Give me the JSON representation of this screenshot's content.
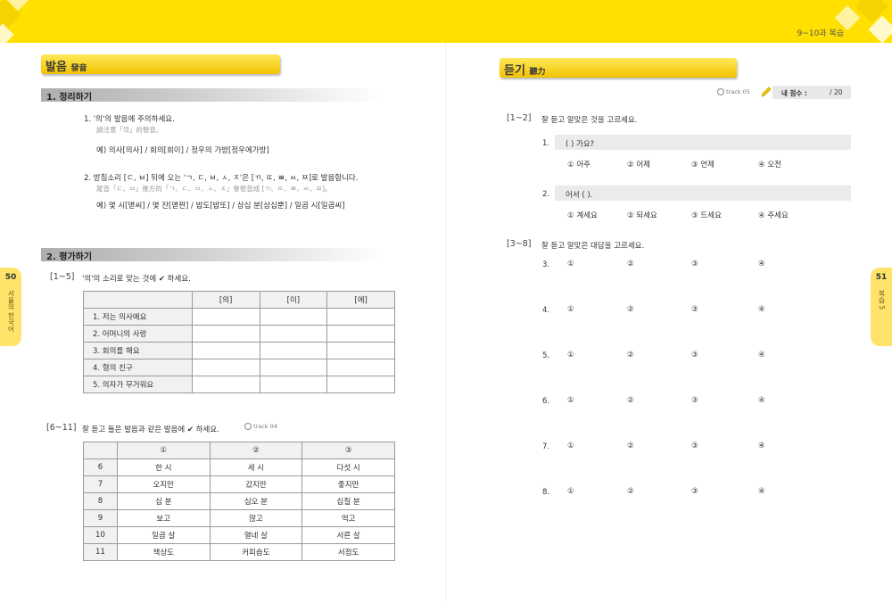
{
  "header": {
    "chapter_label": "9~10과 복습"
  },
  "left": {
    "section_title": "발음",
    "section_title_cn": "發音",
    "sub1_title": "1. 정리하기",
    "rule1": {
      "text": "1.  '의'의 발음에 주의하세요.",
      "cn": "請注意「의」的發音。",
      "example": "예) 의사[의사] / 회의[회이] / 정우의 가방[정우에가방]"
    },
    "rule2": {
      "text": "2.  받침소리 [ㄷ, ㅂ] 뒤에 오는 'ㄱ, ㄷ, ㅂ, ㅅ, ㅈ'은 [ㄲ, ㄸ, ㅃ, ㅆ, ㅉ]로 발음합니다.",
      "cn": "尾音「ㄷ、ㅂ」後方的「ㄱ、ㄷ、ㅂ、ㅅ、ㅈ」會發音成 [ㄲ、ㄸ、ㅃ、ㅆ、ㅉ]。",
      "example": "예) 몇 시[멷씨] / 몇 잔[멷짠] / 밥도[밥또] / 삼십 분[삼십뿐] / 일곱 시[일곱씨]"
    },
    "sub2_title": "2. 평가하기",
    "q1_5": {
      "range": "[1~5]",
      "instruction": "'의'의 소리로 맞는 것에 ✔ 하세요.",
      "headers": [
        "",
        "[의]",
        "[이]",
        "[에]"
      ],
      "rows": [
        "1. 저는 의사예요",
        "2. 어머니의 사랑",
        "3. 회의를 해요",
        "4. 형의 친구",
        "5. 의자가 무거워요"
      ]
    },
    "q6_11": {
      "range": "[6~11]",
      "instruction": "잘 듣고 들은 발음과 같은 발음에 ✔ 하세요.",
      "track": "track 04",
      "headers": [
        "",
        "①",
        "②",
        "③"
      ],
      "rows": [
        [
          "6",
          "한 시",
          "세 시",
          "다섯 시"
        ],
        [
          "7",
          "오지만",
          "갔지만",
          "좋지만"
        ],
        [
          "8",
          "십 분",
          "십오 분",
          "십칠 분"
        ],
        [
          "9",
          "보고",
          "않고",
          "먹고"
        ],
        [
          "10",
          "일곱 살",
          "열네 살",
          "서른 살"
        ],
        [
          "11",
          "책상도",
          "커피숍도",
          "서점도"
        ]
      ]
    },
    "side_tab": {
      "page": "50",
      "text": "서울의 한국어"
    }
  },
  "right": {
    "section_title": "듣기",
    "section_title_cn": "聽力",
    "track": "track 05",
    "score_label": "내 점수 :",
    "score_total": "/ 20",
    "q1_2": {
      "range": "[1~2]",
      "instruction": "잘 듣고 알맞은 것을 고르세요.",
      "items": [
        {
          "num": "1.",
          "prompt": "(              ) 가요?",
          "options": [
            "① 아주",
            "② 어제",
            "③ 언제",
            "④ 오전"
          ]
        },
        {
          "num": "2.",
          "prompt": "어서 (              ).",
          "options": [
            "① 계세요",
            "② 되세요",
            "③ 드세요",
            "④ 주세요"
          ]
        }
      ]
    },
    "q3_8": {
      "range": "[3~8]",
      "instruction": "잘 듣고 알맞은 대답을 고르세요.",
      "items": [
        {
          "num": "3.",
          "options": [
            "①",
            "②",
            "③",
            "④"
          ]
        },
        {
          "num": "4.",
          "options": [
            "①",
            "②",
            "③",
            "④"
          ]
        },
        {
          "num": "5.",
          "options": [
            "①",
            "②",
            "③",
            "④"
          ]
        },
        {
          "num": "6.",
          "options": [
            "①",
            "②",
            "③",
            "④"
          ]
        },
        {
          "num": "7.",
          "options": [
            "①",
            "②",
            "③",
            "④"
          ]
        },
        {
          "num": "8.",
          "options": [
            "①",
            "②",
            "③",
            "④"
          ]
        }
      ]
    },
    "side_tab": {
      "page": "51",
      "text": "복습 5"
    }
  }
}
